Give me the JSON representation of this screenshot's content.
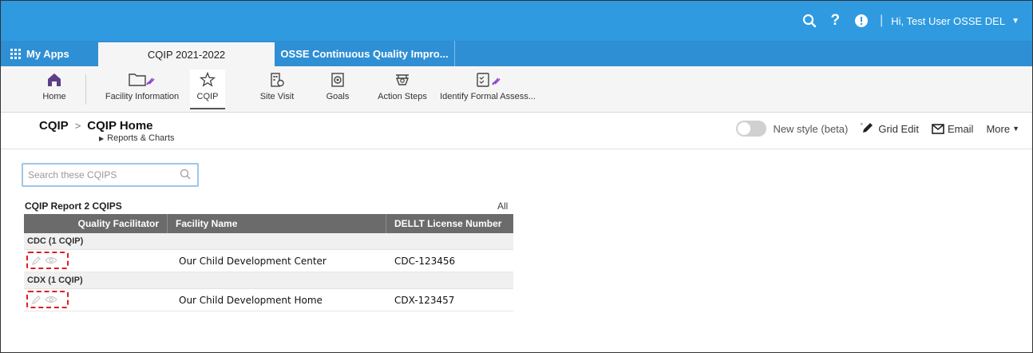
{
  "topbar": {
    "user_label": "Hi, Test User OSSE DEL",
    "icons": [
      "search-icon",
      "help-icon",
      "alert-icon",
      "chevron-down-icon"
    ],
    "color": "#2f9ae0"
  },
  "tabs": {
    "my_apps": "My Apps",
    "active": "CQIP 2021-2022",
    "inactive": "OSSE Continuous Quality Impro..."
  },
  "nav": {
    "items": [
      {
        "label": "Home",
        "icon": "home-icon"
      },
      {
        "label": "Facility Information",
        "icon": "folder-icon"
      },
      {
        "label": "CQIP",
        "icon": "star-icon"
      },
      {
        "label": "Site Visit",
        "icon": "building-icon"
      },
      {
        "label": "Goals",
        "icon": "target-icon"
      },
      {
        "label": "Action Steps",
        "icon": "steps-icon"
      },
      {
        "label": "Identify Formal Assess...",
        "icon": "clipboard-icon"
      }
    ]
  },
  "page": {
    "crumb_root": "CQIP",
    "crumb_current": "CQIP Home",
    "sub": "Reports & Charts",
    "actions": {
      "new_style": "New style (beta)",
      "grid_edit": "Grid Edit",
      "email": "Email",
      "more": "More"
    }
  },
  "search": {
    "placeholder": "Search these CQIPS"
  },
  "report": {
    "title": "CQIP Report 2 CQIPS",
    "all": "All",
    "columns": [
      "Quality Facilitator",
      "Facility Name",
      "DELLT License Number"
    ],
    "groups": [
      {
        "label": "CDC (1 CQIP)",
        "rows": [
          {
            "facilitator": "",
            "facility": "Our Child Development Center",
            "license": "CDC-123456"
          }
        ]
      },
      {
        "label": "CDX (1 CQIP)",
        "rows": [
          {
            "facilitator": "",
            "facility": "Our Child Development Home",
            "license": "CDX-123457"
          }
        ]
      }
    ]
  }
}
